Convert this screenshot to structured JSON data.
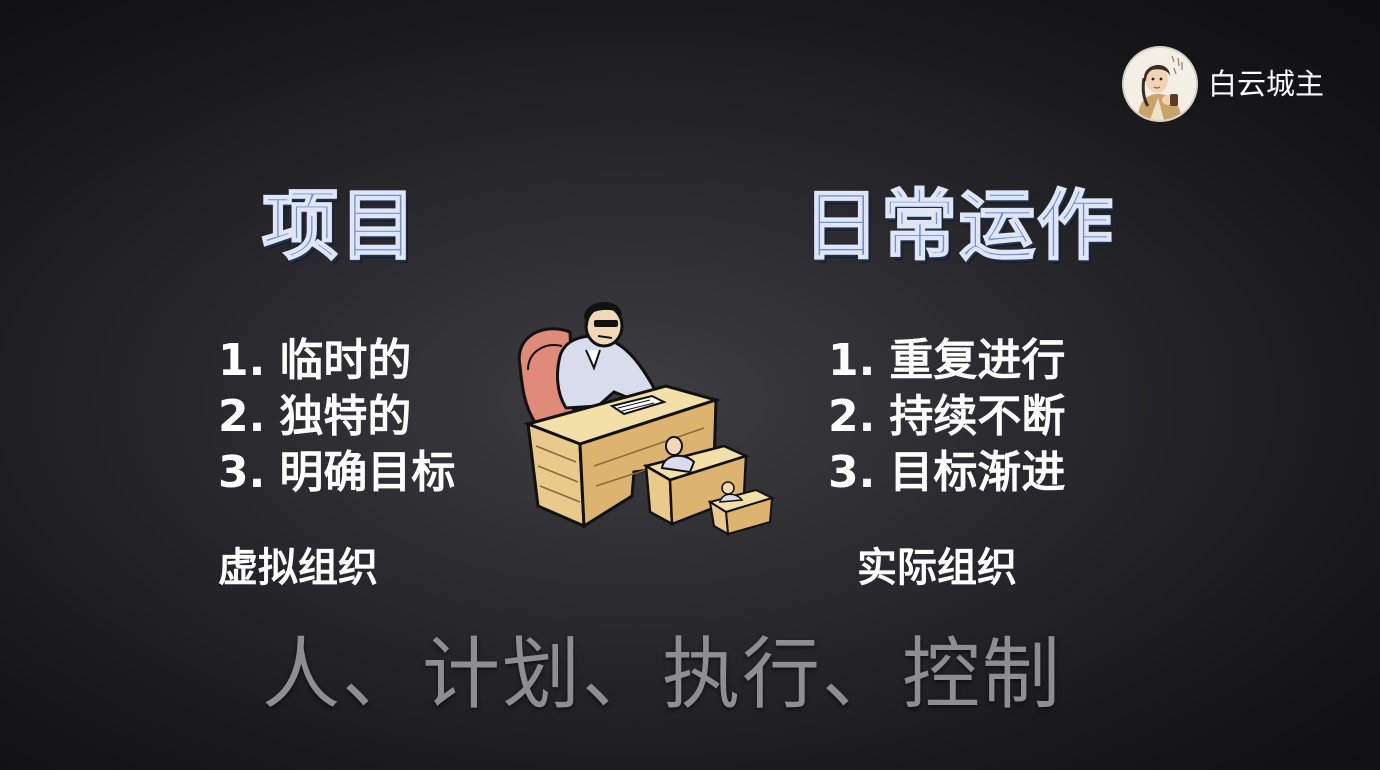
{
  "author": {
    "name": "白云城主",
    "avatar_icon": "avatar-portrait-icon"
  },
  "left": {
    "heading": "项目",
    "items": [
      {
        "num": "1.",
        "text": "临时的"
      },
      {
        "num": "2.",
        "text": "独特的"
      },
      {
        "num": "3.",
        "text": "明确目标"
      }
    ],
    "org": "虚拟组织"
  },
  "right": {
    "heading": "日常运作",
    "items": [
      {
        "num": "1.",
        "text": "重复进行"
      },
      {
        "num": "2.",
        "text": "持续不断"
      },
      {
        "num": "3.",
        "text": "目标渐进"
      }
    ],
    "org": "实际组织"
  },
  "bottom_text": "人、计划、执行、控制",
  "illustration_icon": "manager-desk-clipart-icon",
  "colors": {
    "heading": "#6f8ed6",
    "text": "#ffffff",
    "bottom_text": "#8e8e92",
    "background": "#1c1c1f"
  }
}
